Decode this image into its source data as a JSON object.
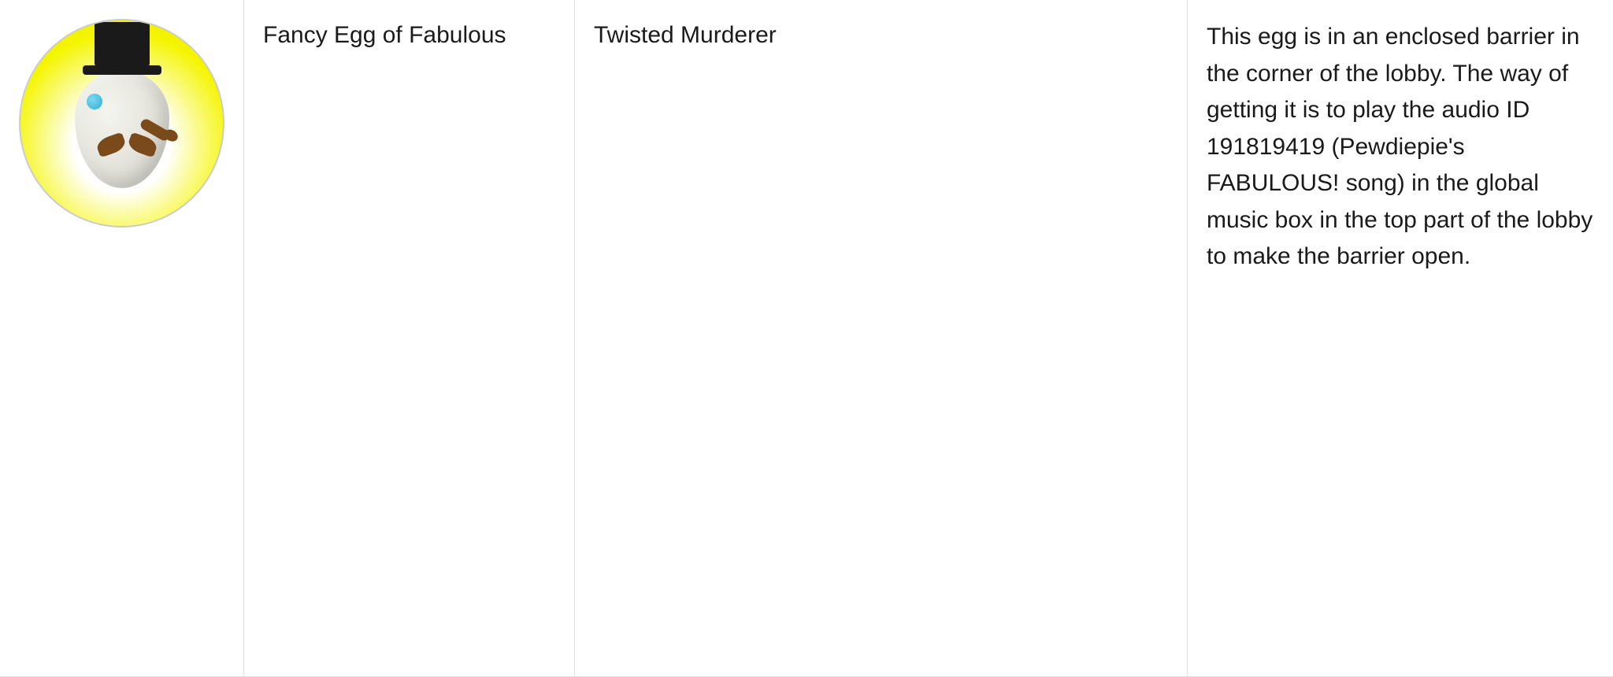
{
  "row": {
    "egg_name": "Fancy Egg of Fabulous",
    "game_name": "Twisted Murderer",
    "description": "This egg is in an enclosed barrier in the corner of the lobby. The way of getting it is to play the audio ID 191819419 (Pewdiepie's FABULOUS! song) in the global music box in the top part of the lobby to make the barrier open.",
    "image_alt": "Fancy Egg of Fabulous"
  }
}
